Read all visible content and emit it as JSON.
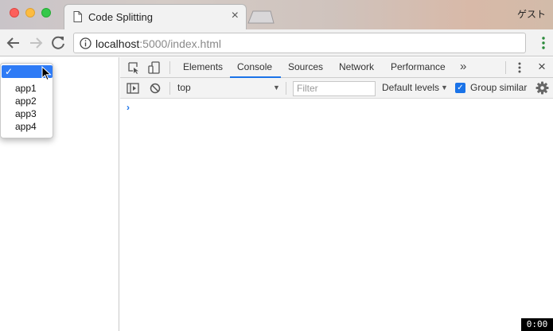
{
  "browser": {
    "tab_title": "Code Splitting",
    "tab_close": "×",
    "profile_name": "ゲスト",
    "url_host": "localhost",
    "url_rest": ":5000/index.html"
  },
  "page": {
    "select_options": [
      {
        "label": "✓",
        "selected": true
      },
      {
        "label": "app1",
        "selected": false
      },
      {
        "label": "app2",
        "selected": false
      },
      {
        "label": "app3",
        "selected": false
      },
      {
        "label": "app4",
        "selected": false
      }
    ]
  },
  "devtools": {
    "tabs": [
      "Elements",
      "Console",
      "Sources",
      "Network",
      "Performance"
    ],
    "active_tab": "Console",
    "more_tabs": "»",
    "close": "×",
    "context": "top",
    "filter_placeholder": "Filter",
    "levels": "Default levels",
    "group_similar": "Group similar",
    "group_similar_checked": true,
    "prompt": "›",
    "accent_color": "#1a73e8"
  },
  "recording_timer": "0:00"
}
